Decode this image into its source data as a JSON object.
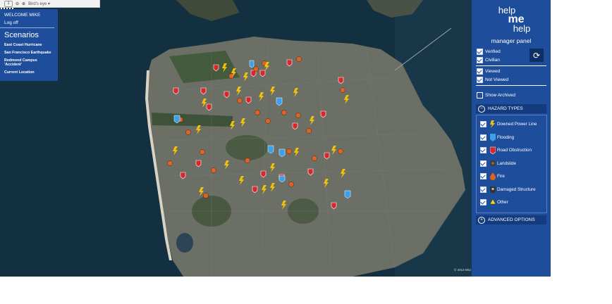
{
  "toolbar": {
    "nav_label": "1",
    "view_label": "Bird's eye ▾"
  },
  "user": {
    "welcome": "WELCOME MIKE",
    "logoff": "Log off"
  },
  "scenarios": {
    "title": "Scenarios",
    "items": [
      "East Coast Hurricane",
      "San Francisco Earthquake",
      "Redmond Campus 'Accident'",
      "Current Location"
    ]
  },
  "app": {
    "logo_line1": "help",
    "logo_line2": "me",
    "logo_line3": "help",
    "panel_title": "manager panel"
  },
  "filters": {
    "verified": "Verified",
    "civilian": "Civilian",
    "viewed": "Viewed",
    "not_viewed": "Not Viewed",
    "show_archived": "Show Archived",
    "refresh_icon": "refresh-icon"
  },
  "hazards": {
    "header": "HAZARD TYPES",
    "collapse_symbol": "−",
    "items": [
      {
        "label": "Downed Power Line",
        "icon": "lightning-icon",
        "color": "#f2c20a"
      },
      {
        "label": "Flooding",
        "icon": "flood-icon",
        "color": "#3aa0e8"
      },
      {
        "label": "Road Obstruction",
        "icon": "road-obstruction-icon",
        "color": "#d8262b"
      },
      {
        "label": "Landslide",
        "icon": "landslide-icon",
        "color": "#3a3a3a"
      },
      {
        "label": "Fire",
        "icon": "fire-icon",
        "color": "#e4621f"
      },
      {
        "label": "Damaged Structure",
        "icon": "damaged-structure-icon",
        "color": "#555555"
      },
      {
        "label": "Other",
        "icon": "other-icon",
        "color": "#f2d90a"
      }
    ]
  },
  "advanced": {
    "label": "ADVANCED OPTIONS",
    "expand_symbol": "+"
  },
  "map": {
    "copyright": "© 2013 Micr"
  },
  "colors": {
    "panel": "#1e4d9b",
    "panel_dark": "#143b7e",
    "ocean": "#0f2a3a",
    "land": "#6b6f66"
  }
}
